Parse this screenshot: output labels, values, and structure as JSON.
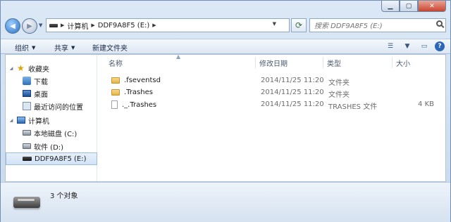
{
  "window": {
    "caption": {
      "minimize": "▁",
      "maximize": "▢",
      "close": "✕"
    }
  },
  "address": {
    "segments": [
      "计算机",
      "DDF9A8F5 (E:)"
    ],
    "search_placeholder": "搜索 DDF9A8F5 (E:)"
  },
  "toolbar": {
    "organize": "组织",
    "share": "共享",
    "new_folder": "新建文件夹"
  },
  "nav": {
    "favorites": "收藏夹",
    "downloads": "下载",
    "desktop": "桌面",
    "recent": "最近访问的位置",
    "computer": "计算机",
    "local_disk": "本地磁盘 (C:)",
    "software": "软件 (D:)",
    "external": "DDF9A8F5 (E:)"
  },
  "columns": {
    "name": "名称",
    "date": "修改日期",
    "type": "类型",
    "size": "大小"
  },
  "files": [
    {
      "name": ".fseventsd",
      "date": "2014/11/25 11:20",
      "type": "文件夹",
      "size": ""
    },
    {
      "name": ".Trashes",
      "date": "2014/11/25 11:20",
      "type": "文件夹",
      "size": ""
    },
    {
      "name": "._.Trashes",
      "date": "2014/11/25 11:20",
      "type": "TRASHES 文件",
      "size": "4 KB"
    }
  ],
  "details": {
    "count": "3 个对象"
  },
  "colors": {
    "selection": "#d2e3f6",
    "folder": "#e3b548",
    "help": "#2d67b8"
  }
}
